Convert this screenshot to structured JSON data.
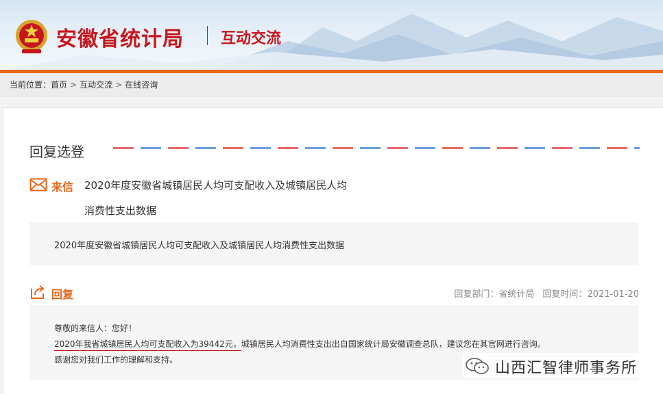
{
  "header": {
    "site_title": "安徽省统计局",
    "section_title": "互动交流"
  },
  "breadcrumb": {
    "prefix": "当前位置：",
    "items": [
      "首页",
      "互动交流",
      "在线咨询"
    ],
    "separator": ">"
  },
  "main": {
    "heading": "回复选登",
    "letter": {
      "label": "来信",
      "title_line1": "2020年度安徽省城镇居民人均可支配收入及城镇居民人均",
      "title_line2": "消费性支出数据",
      "body": "2020年度安徽省城镇居民人均可支配收入及城镇居民人均消费性支出数据"
    },
    "reply": {
      "label": "回复",
      "dept_label": "回复部门：",
      "dept_value": "省统计局",
      "time_label": "回复时间：",
      "time_value": "2021-01-20",
      "line1": "尊敬的来信人：您好！",
      "line2_highlight": "2020年我省城镇居民人均可支配收入为39442元，",
      "line2_rest": "城镇居民人均消费性支出出自国家统计局安徽调查总队，建议您在其官网进行咨询。",
      "line3": "感谢您对我们工作的理解和支持。"
    }
  },
  "watermark": {
    "text": "山西汇智律师事务所"
  },
  "colors": {
    "brand_red": "#c8161d",
    "accent_orange": "#e8671a"
  },
  "icons": {
    "emblem": "national-emblem-icon",
    "letter": "envelope-icon",
    "reply": "reply-share-icon",
    "watermark": "wechat-icon"
  }
}
